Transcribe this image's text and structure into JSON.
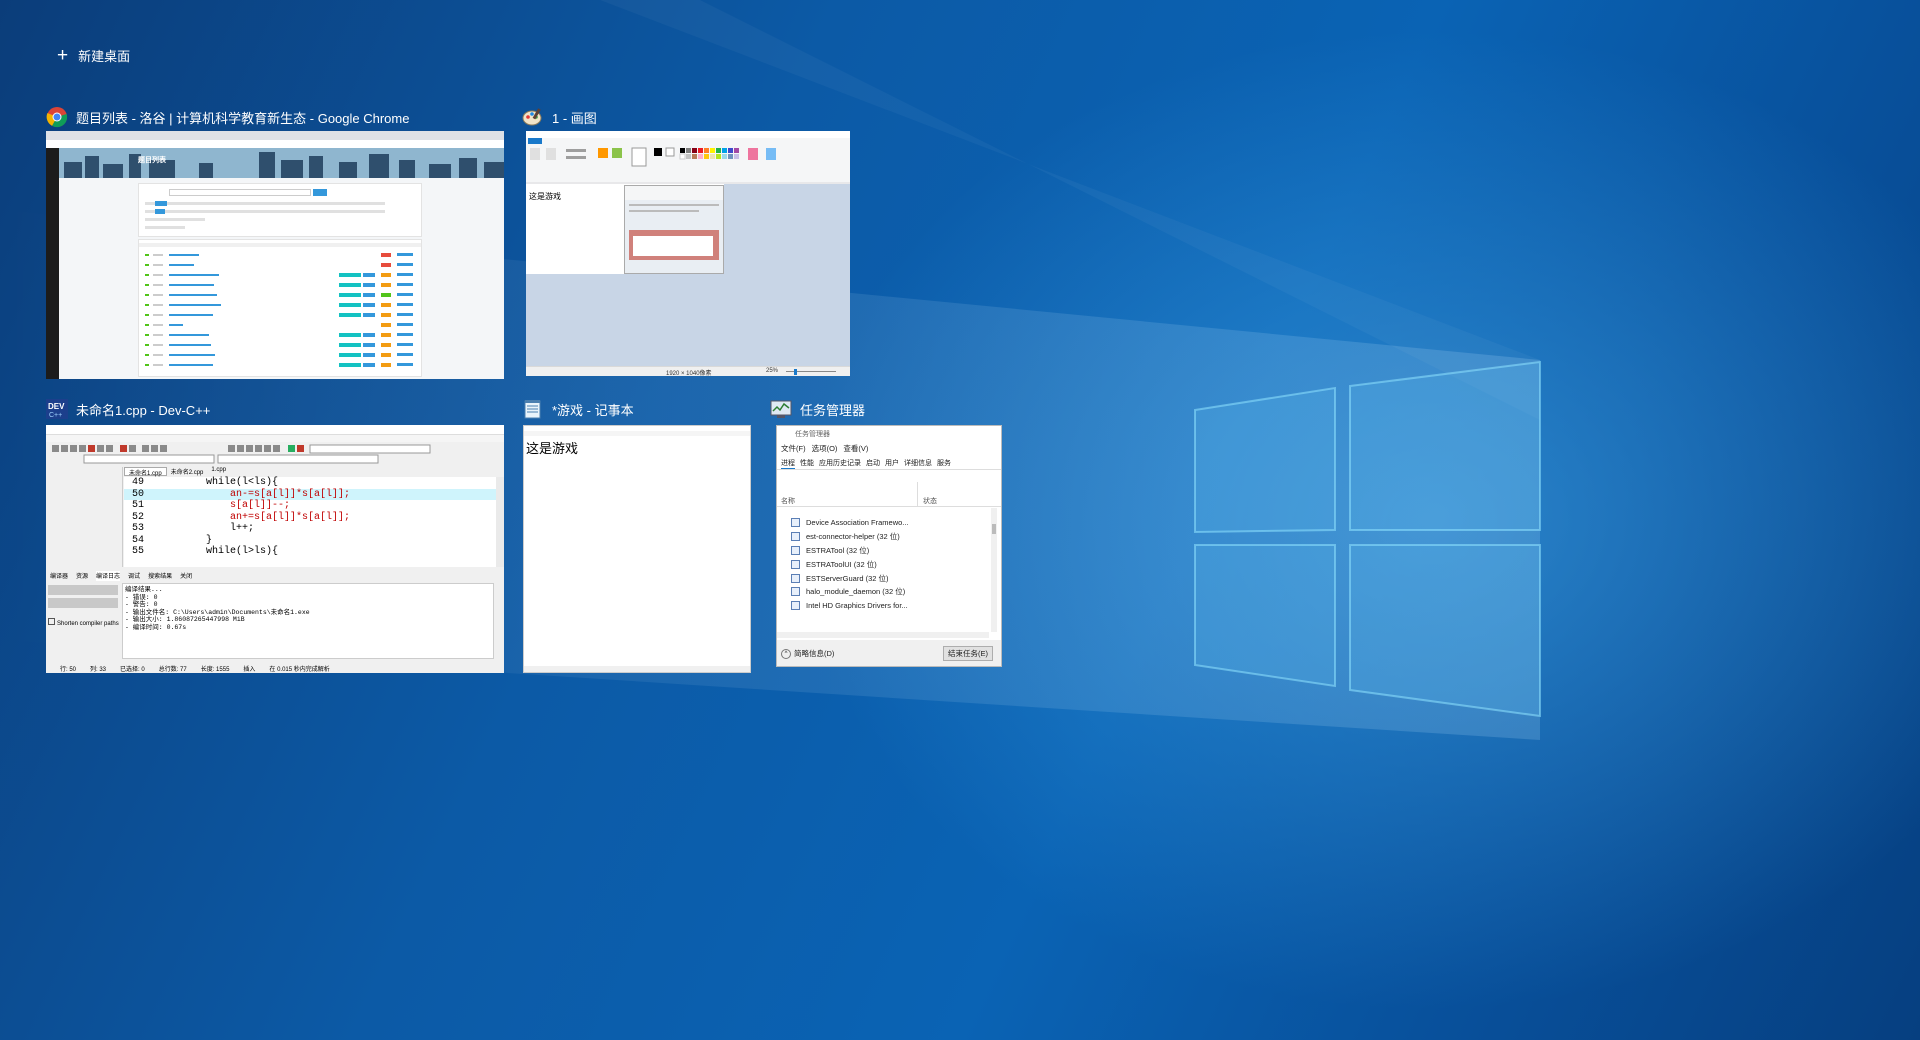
{
  "new_desktop": {
    "label": "新建桌面"
  },
  "windows": {
    "chrome": {
      "title": "题目列表 - 洛谷 | 计算机科学教育新生态 - Google Chrome",
      "page_title": "题目列表"
    },
    "paint": {
      "title": "1 - 画图",
      "canvas_text": "这是游戏",
      "status_size": "1920 × 1040像素",
      "zoom": "25%"
    },
    "devcpp": {
      "title": "未命名1.cpp - Dev-C++",
      "tabs": [
        "未命名1.cpp",
        "未命名2.cpp",
        "1.cpp"
      ],
      "code_lines": [
        {
          "num": "49",
          "text": "        while(l<ls){"
        },
        {
          "num": "50",
          "text": "            an-=s[a[l]]*s[a[l]];"
        },
        {
          "num": "51",
          "text": "            s[a[l]]--;"
        },
        {
          "num": "52",
          "text": "            an+=s[a[l]]*s[a[l]];"
        },
        {
          "num": "53",
          "text": "            l++;"
        },
        {
          "num": "54",
          "text": "        }"
        },
        {
          "num": "55",
          "text": "        while(l>ls){"
        }
      ],
      "bottom_tabs": [
        "编译器",
        "资源",
        "编译日志",
        "调试",
        "搜索结果",
        "关闭"
      ],
      "log": [
        "编译结果...",
        "- 错误: 0",
        "- 警告: 0",
        "- 输出文件名: C:\\Users\\admin\\Documents\\未命名1.exe",
        "- 输出大小: 1.86087265447998 MiB",
        "- 编译时间: 0.67s"
      ],
      "shorten_label": "Shorten compiler paths",
      "status": [
        "行: 50",
        "列: 33",
        "已选择: 0",
        "总行数: 77",
        "长度: 1555",
        "插入",
        "在 0.015 秒内完成解析"
      ]
    },
    "notepad": {
      "title": "*游戏 - 记事本",
      "content": "这是游戏"
    },
    "taskmgr": {
      "title": "任务管理器",
      "window_caption": "任务管理器",
      "menu": [
        "文件(F)",
        "选项(O)",
        "查看(V)"
      ],
      "tabs": [
        "进程",
        "性能",
        "应用历史记录",
        "启动",
        "用户",
        "详细信息",
        "服务"
      ],
      "col_name": "名称",
      "col_status": "状态",
      "processes": [
        "Device Association Framewo...",
        "est-connector-helper (32 位)",
        "ESTRATool (32 位)",
        "ESTRAToolUI (32 位)",
        "ESTServerGuard (32 位)",
        "halo_module_daemon (32 位)",
        "Intel HD Graphics Drivers for..."
      ],
      "less_details": "简略信息(D)",
      "end_task": "结束任务(E)"
    }
  }
}
